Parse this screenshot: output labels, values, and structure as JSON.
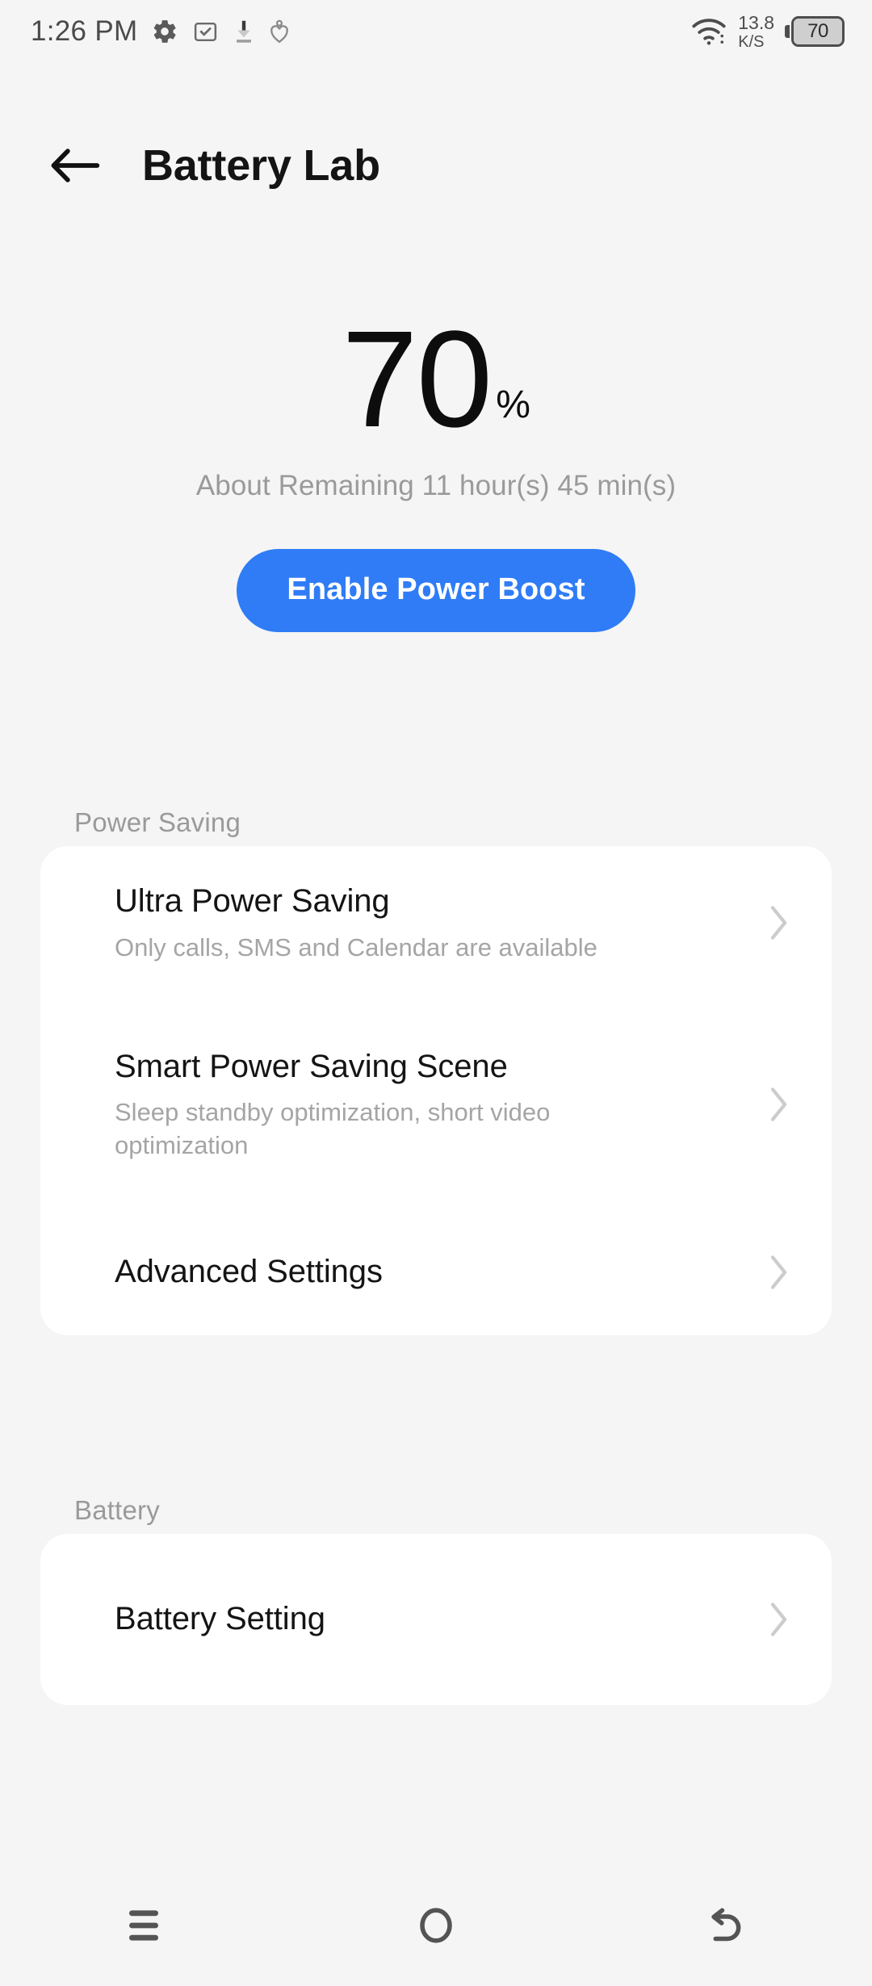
{
  "status_bar": {
    "time": "1:26 PM",
    "left_icons": [
      {
        "name": "gear-icon"
      },
      {
        "name": "mail-checkbox-icon"
      },
      {
        "name": "download-icon"
      },
      {
        "name": "heart-pin-icon"
      }
    ],
    "wifi_icon": "wifi-icon",
    "network_speed_value": "13.8",
    "network_speed_unit": "K/S",
    "battery_level_text": "70"
  },
  "header": {
    "back_icon": "back-arrow-icon",
    "title": "Battery Lab"
  },
  "hero": {
    "battery_percent": "70",
    "percent_symbol": "%",
    "remaining_text": "About Remaining 11 hour(s)  45 min(s)",
    "boost_button_label": "Enable Power Boost",
    "accent_color": "#2f7cf6"
  },
  "sections": [
    {
      "label": "Power Saving",
      "rows": [
        {
          "title": "Ultra Power Saving",
          "subtitle": "Only calls, SMS and Calendar are available",
          "chevron": "chevron-right-icon"
        },
        {
          "title": "Smart Power Saving Scene",
          "subtitle": "Sleep standby optimization, short video optimization",
          "chevron": "chevron-right-icon"
        },
        {
          "title": "Advanced Settings",
          "subtitle": "",
          "chevron": "chevron-right-icon"
        }
      ]
    },
    {
      "label": "Battery",
      "rows": [
        {
          "title": "Battery Setting",
          "subtitle": "",
          "chevron": "chevron-right-icon"
        }
      ]
    }
  ],
  "nav_bar": {
    "recents_icon": "menu-recents-icon",
    "home_icon": "home-circle-icon",
    "back_icon": "back-return-icon"
  }
}
